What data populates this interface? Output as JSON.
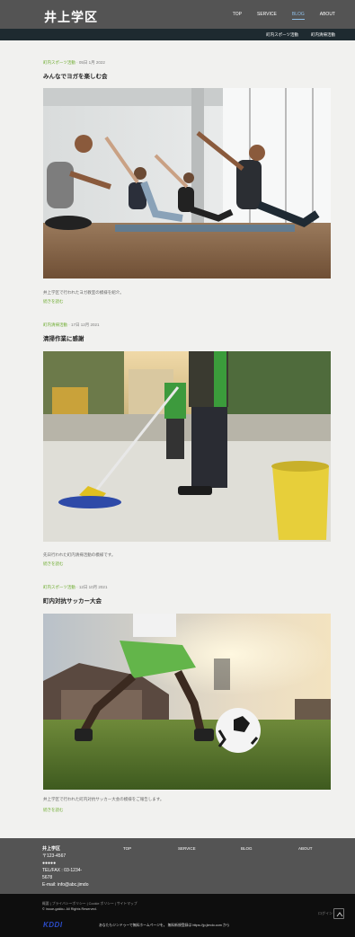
{
  "header": {
    "logo": "井上学区",
    "nav": [
      "TOP",
      "SERVICE",
      "BLOG",
      "ABOUT"
    ],
    "active_nav": "BLOG",
    "subnav": [
      "町内スポーツ活動",
      "町内清掃活動"
    ]
  },
  "posts": [
    {
      "category": "町内スポーツ活動",
      "date": " · 05日 1月 2022",
      "title": "みんなでヨガを楽しむ会",
      "description": "井上学区で行われたヨガ教室の模様を紹介。",
      "more": "続きを読む",
      "image": "yoga-class-photo"
    },
    {
      "category": "町内清掃活動",
      "date": " · 17日 12月 2021",
      "title": "清掃作業に感謝",
      "description": "先日行われた町内清掃活動の模様です。",
      "more": "続きを読む",
      "image": "cleaning-mop-photo"
    },
    {
      "category": "町内スポーツ活動",
      "date": " · 12日 10月 2021",
      "title": "町内対抗サッカー大会",
      "description": "井上学区で行われた町内対抗サッカー大会の模様をご報告します。",
      "more": "続きを読む",
      "image": "soccer-kids-photo"
    }
  ],
  "footer": {
    "name": "井上学区",
    "postal": "〒123-4567",
    "address": "●●●●●",
    "tel1": "TEL/FAX : 03-1234-",
    "tel2": "5678",
    "email": "E-mail: info@abc.jimdo",
    "links": [
      "TOP",
      "SERVICE",
      "BLOG",
      "ABOUT"
    ]
  },
  "bottom": {
    "legal": "概要 | プライバシーポリシー | Cookie ポリシー | サイトマップ",
    "copyright": "© inoue-gakku. All Rights Reserved.",
    "kddi": "KDDI",
    "promo": "あなたもジンドゥーで無料ホームページを。 無料新規登録は https://jp.jimdo.com から",
    "login": "ログイン"
  },
  "colors": {
    "header_bg": "#545454",
    "subnav_bg": "#1e2a30",
    "accent_green": "#6cab2d",
    "active_nav": "#8fbfe8",
    "page_bg": "#f1f1ef"
  }
}
